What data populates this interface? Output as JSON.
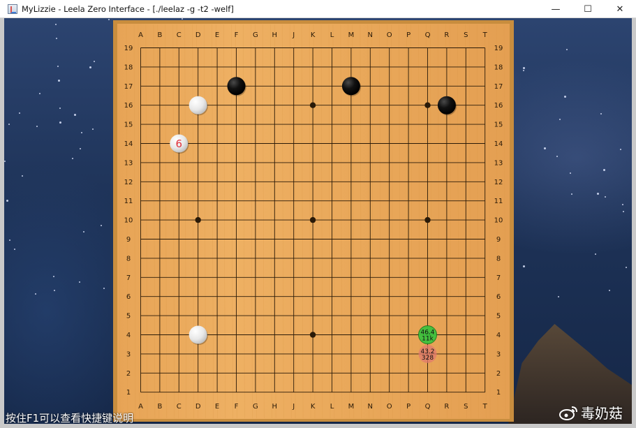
{
  "window": {
    "title": "MyLizzie - Leela Zero Interface - [./leelaz -g -t2 -welf]",
    "minimize_glyph": "—",
    "maximize_glyph": "☐",
    "close_glyph": "✕"
  },
  "board": {
    "size": 19,
    "columns": [
      "A",
      "B",
      "C",
      "D",
      "E",
      "F",
      "G",
      "H",
      "J",
      "K",
      "L",
      "M",
      "N",
      "O",
      "P",
      "Q",
      "R",
      "S",
      "T"
    ],
    "rows": [
      "19",
      "18",
      "17",
      "16",
      "15",
      "14",
      "13",
      "12",
      "11",
      "10",
      "9",
      "8",
      "7",
      "6",
      "5",
      "4",
      "3",
      "2",
      "1"
    ],
    "hoshi": [
      "D16",
      "K16",
      "Q16",
      "D10",
      "K10",
      "Q10",
      "D4",
      "K4",
      "Q4"
    ],
    "stones": [
      {
        "point": "F17",
        "color": "black"
      },
      {
        "point": "M17",
        "color": "black"
      },
      {
        "point": "R16",
        "color": "black"
      },
      {
        "point": "D16",
        "color": "white"
      },
      {
        "point": "C14",
        "color": "white",
        "move_number": "6"
      },
      {
        "point": "D4",
        "color": "white"
      }
    ],
    "suggestions": [
      {
        "point": "Q4",
        "winrate": "46.4",
        "playouts": "11k",
        "color": "#3ec23e",
        "best": true
      },
      {
        "point": "Q3",
        "winrate": "43.2",
        "playouts": "328",
        "color": "#e07a6e",
        "best": false
      }
    ],
    "colors": {
      "wood": "#e9a85a",
      "wood_edge": "#c88d3e",
      "line": "#2a1a08",
      "move_number": "#e0303a"
    }
  },
  "footer": {
    "hint": "按住F1可以查看快捷键说明",
    "watermark": "毒奶菇"
  }
}
